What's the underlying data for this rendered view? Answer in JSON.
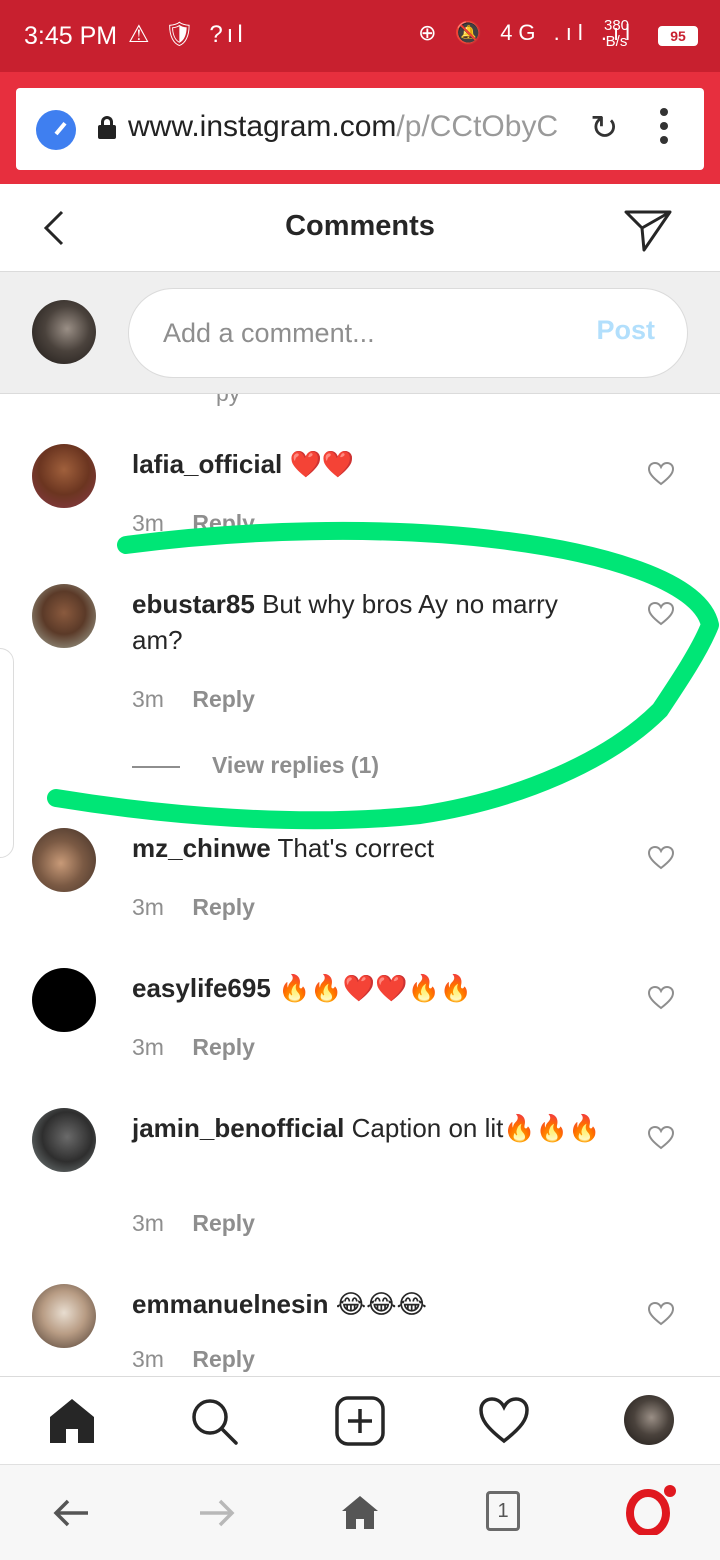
{
  "status_bar": {
    "time": "3:45 PM",
    "left_icons": "⚠ 🛡 ?ıl",
    "right_icons": "⊕ 🔕 4G .ıl .ıl",
    "net_speed_value": "380",
    "net_speed_unit": "B/s",
    "battery": "95",
    "bg_color": "#c8202f"
  },
  "browser": {
    "url_domain": "www.instagram.com",
    "url_path": "/p/CCtObyC",
    "tab_count": "1"
  },
  "header": {
    "title": "Comments"
  },
  "comment_input": {
    "placeholder": "Add a comment...",
    "post_label": "Post"
  },
  "comments": [
    {
      "username": "lafia_official",
      "text": "❤️❤️",
      "time": "3m",
      "reply_label": "Reply"
    },
    {
      "username": "ebustar85",
      "text": "But why bros Ay no marry am?",
      "time": "3m",
      "reply_label": "Reply",
      "view_replies": "View replies (1)"
    },
    {
      "username": "mz_chinwe",
      "text": "That's correct",
      "time": "3m",
      "reply_label": "Reply"
    },
    {
      "username": "easylife695",
      "text": "🔥🔥❤️❤️🔥🔥",
      "time": "3m",
      "reply_label": "Reply"
    },
    {
      "username": "jamin_benofficial",
      "text": "Caption on lit🔥🔥🔥",
      "time": "3m",
      "reply_label": "Reply"
    },
    {
      "username": "emmanuelnesin",
      "text": "😂😂😂",
      "time": "3m",
      "reply_label": "Reply"
    }
  ],
  "colors": {
    "highlight": "#00e676",
    "browser_red": "#e72f3e",
    "post_disabled": "#b2dffc"
  }
}
